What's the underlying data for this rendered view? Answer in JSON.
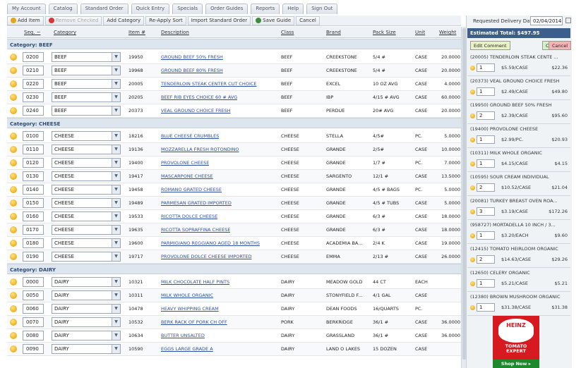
{
  "nav_tabs": [
    "My Account",
    "Catalog",
    "Standard Order",
    "Quick Entry",
    "Specials",
    "Order Guides",
    "Reports",
    "Help",
    "Sign Out"
  ],
  "toolbar": {
    "add_item": "Add Item",
    "remove_checked": "Remove Checked",
    "add_category": "Add Category",
    "reapply_sort": "Re-Apply Sort",
    "import_standard_order": "Import Standard Order",
    "save_guide": "Save Guide",
    "cancel": "Cancel"
  },
  "columns": {
    "seq": "Seq. ~",
    "category": "Category",
    "item": "Item #",
    "description": "Description",
    "class": "Class",
    "brand": "Brand",
    "pack": "Pack Size",
    "unit": "Unit",
    "weight": "Weight"
  },
  "groups": [
    {
      "label": "Category: BEEF",
      "rows": [
        {
          "seq": "0200",
          "cat": "BEEF",
          "item": "19950",
          "desc": "GROUND BEEF 50% FRESH",
          "cls": "BEEF",
          "brand": "CREEKSTONE",
          "pack": "5/4 #",
          "unit": "CASE",
          "wt": "20.0000"
        },
        {
          "seq": "0210",
          "cat": "BEEF",
          "item": "19968",
          "desc": "GROUND BEEF 80% FRESH",
          "cls": "BEEF",
          "brand": "CREEKSTONE",
          "pack": "5/4 #",
          "unit": "CASE",
          "wt": "20.0000"
        },
        {
          "seq": "0220",
          "cat": "BEEF",
          "item": "20005",
          "desc": "TENDERLOIN STEAK CENTER CUT CHOICE",
          "cls": "BEEF",
          "brand": "EXCEL",
          "pack": "10 OZ AVG",
          "unit": "CASE",
          "wt": "4.0000"
        },
        {
          "seq": "0230",
          "cat": "BEEF",
          "item": "20205",
          "desc": "BEEF RIB EYES CHOICE 60 # AVG",
          "cls": "BEEF",
          "brand": "IBP",
          "pack": "4/15 # AVG",
          "unit": "CASE",
          "wt": "60.0000"
        },
        {
          "seq": "0240",
          "cat": "BEEF",
          "item": "20373",
          "desc": "VEAL GROUND CHOICE FRESH",
          "cls": "BEEF",
          "brand": "PERDUE",
          "pack": "20# AVG",
          "unit": "CASE",
          "wt": "20.0000"
        }
      ]
    },
    {
      "label": "Category: CHEESE",
      "rows": [
        {
          "seq": "0100",
          "cat": "CHEESE",
          "item": "18216",
          "desc": "BLUE CHEESE CRUMBLES",
          "cls": "CHEESE",
          "brand": "STELLA",
          "pack": "4/5#",
          "unit": "PC.",
          "wt": "5.0000"
        },
        {
          "seq": "0110",
          "cat": "CHEESE",
          "item": "19136",
          "desc": "MOZZARELLA FRESH ROTONDINO",
          "cls": "CHEESE",
          "brand": "GRANDE",
          "pack": "2/5#",
          "unit": "CASE",
          "wt": "10.0000"
        },
        {
          "seq": "0120",
          "cat": "CHEESE",
          "item": "19400",
          "desc": "PROVOLONE CHEESE",
          "cls": "CHEESE",
          "brand": "GRANDE",
          "pack": "1/7 #",
          "unit": "PC.",
          "wt": "7.0000"
        },
        {
          "seq": "0130",
          "cat": "CHEESE",
          "item": "19417",
          "desc": "MASCARPONE CHEESE",
          "cls": "CHEESE",
          "brand": "SARGENTO",
          "pack": "12/1 #",
          "unit": "CASE",
          "wt": "13.5000"
        },
        {
          "seq": "0140",
          "cat": "CHEESE",
          "item": "19458",
          "desc": "ROMANO GRATED CHEESE",
          "cls": "CHEESE",
          "brand": "GRANDE",
          "pack": "4/5 # BAGS",
          "unit": "PC.",
          "wt": "5.0000"
        },
        {
          "seq": "0150",
          "cat": "CHEESE",
          "item": "19489",
          "desc": "PARMESAN GRATED IMPORTED",
          "cls": "CHEESE",
          "brand": "GRANDE",
          "pack": "4/5 # TUBS",
          "unit": "CASE",
          "wt": "5.0000"
        },
        {
          "seq": "0160",
          "cat": "CHEESE",
          "item": "19533",
          "desc": "RICOTTA DOLCE CHEESE",
          "cls": "CHEESE",
          "brand": "GRANDE",
          "pack": "6/3 #",
          "unit": "CASE",
          "wt": "18.0000"
        },
        {
          "seq": "0170",
          "cat": "CHEESE",
          "item": "19635",
          "desc": "RICOTTA SOPRAFFINA CHEESE",
          "cls": "CHEESE",
          "brand": "GRANDE",
          "pack": "6/3 #",
          "unit": "CASE",
          "wt": "18.0000"
        },
        {
          "seq": "0180",
          "cat": "CHEESE",
          "item": "19600",
          "desc": "PARMIGIANO REGGIANO AGED 18 MONTHS",
          "cls": "CHEESE",
          "brand": "ACADEMIA BA...",
          "pack": "2/4 K",
          "unit": "CASE",
          "wt": "19.0000"
        },
        {
          "seq": "0190",
          "cat": "CHEESE",
          "item": "19717",
          "desc": "PROVOLONE DOLCE CHEESE IMPORTED",
          "cls": "CHEESE",
          "brand": "EMMA",
          "pack": "2/13 #",
          "unit": "CASE",
          "wt": "26.0000"
        }
      ]
    },
    {
      "label": "Category: DAIRY",
      "rows": [
        {
          "seq": "0000",
          "cat": "DAIRY",
          "item": "10321",
          "desc": "MILK CHOCOLATE HALF PINTS",
          "cls": "DAIRY",
          "brand": "MEADOW GOLD",
          "pack": "44 CT",
          "unit": "EACH",
          "wt": ""
        },
        {
          "seq": "0050",
          "cat": "DAIRY",
          "item": "10311",
          "desc": "MILK WHOLE ORGANIC",
          "cls": "DAIRY",
          "brand": "STONYFIELD F...",
          "pack": "4/1 GAL",
          "unit": "CASE",
          "wt": ""
        },
        {
          "seq": "0060",
          "cat": "DAIRY",
          "item": "10478",
          "desc": "HEAVY WHIPPING CREAM",
          "cls": "DAIRY",
          "brand": "DEAN FOODS",
          "pack": "16/QUARTS",
          "unit": "PC.",
          "wt": ""
        },
        {
          "seq": "0070",
          "cat": "DAIRY",
          "item": "10532",
          "desc": "BERK RACK OF PORK CH OFF",
          "cls": "PORK",
          "brand": "BERKRIDGE",
          "pack": "36/1 #",
          "unit": "CASE",
          "wt": "36.0000"
        },
        {
          "seq": "0080",
          "cat": "DAIRY",
          "item": "10634",
          "desc": "BUTTER UNSALTED",
          "cls": "DAIRY",
          "brand": "GRASSLAND",
          "pack": "36/1 #",
          "unit": "CASE",
          "wt": "36.0000"
        },
        {
          "seq": "0090",
          "cat": "DAIRY",
          "item": "10590",
          "desc": "EGGS LARGE GRADE A",
          "cls": "DAIRY",
          "brand": "LAND O LAKES",
          "pack": "15 DOZEN",
          "unit": "CASE",
          "wt": ""
        }
      ]
    }
  ],
  "right": {
    "delivery_label": "Requested Delivery Date:",
    "delivery_date": "02/04/2014",
    "estimated": "Estimated Total: $497.95",
    "edit_comment": "Edit Comment",
    "complete": "Complete",
    "cancel": "Cancel",
    "items": [
      {
        "title": "(20005) TENDERLOIN STEAK CENTE ...",
        "qty": "1",
        "price": "$5.59/CASE",
        "total": "$22.36"
      },
      {
        "title": "(20373) VEAL GROUND CHOICE FRESH",
        "qty": "1",
        "price": "$2.49/CASE",
        "total": "$49.80"
      },
      {
        "title": "(19950) GROUND BEEF 50% FRESH",
        "qty": "2",
        "price": "$2.39/CASE",
        "total": "$95.60"
      },
      {
        "title": "(19400) PROVOLONE CHEESE",
        "qty": "1",
        "price": "$2.99/PC.",
        "total": "$20.93"
      },
      {
        "title": "(10311) MILK WHOLE ORGANIC",
        "qty": "1",
        "price": "$4.15/CASE",
        "total": "$4.15"
      },
      {
        "title": "(10595) SOUR CREAM INDIVIDUAL",
        "qty": "2",
        "price": "$10.52/CASE",
        "total": "$21.04"
      },
      {
        "title": "(20081) TURKEY BREAST OVEN ROA...",
        "qty": "3",
        "price": "$3.19/CASE",
        "total": "$172.26"
      },
      {
        "title": "(958727) MORTADELLA 10 INCH / 3...",
        "qty": "1",
        "price": "$3.20/EACH",
        "total": "$9.60"
      },
      {
        "title": "(12415) TOMATO HEIRLOOM ORGANIC",
        "qty": "2",
        "price": "$14.63/CASE",
        "total": "$29.26"
      },
      {
        "title": "(12650) CELERY ORGANIC",
        "qty": "1",
        "price": "$5.21/CASE",
        "total": "$5.21"
      },
      {
        "title": "(12380) BROWN MUSHROOM ORGANIC",
        "qty": "1",
        "price": "$31.38/CASE",
        "total": "$31.38"
      }
    ],
    "ad": {
      "logo": "HEINZ",
      "line1": "TOMATO",
      "line2": "EXPERT",
      "shop": "Shop Now ▸"
    }
  }
}
